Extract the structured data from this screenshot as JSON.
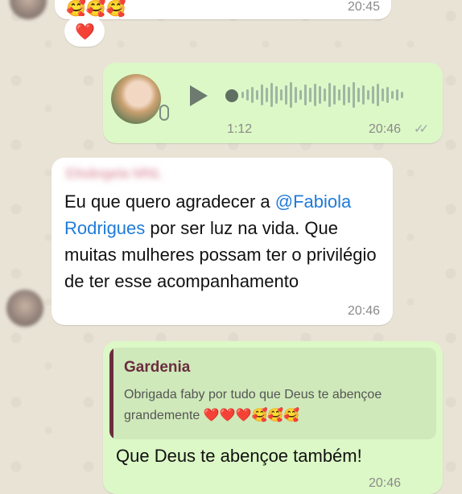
{
  "messages": {
    "top": {
      "emojis": "🥰🥰🥰",
      "time": "20:45"
    },
    "reaction": {
      "emoji": "❤️"
    },
    "voice": {
      "duration": "1:12",
      "time": "20:46"
    },
    "incoming": {
      "sender": "Elisângela MNL",
      "text_before": "Eu que quero agradecer a ",
      "mention": "@Fabiola Rodrigues",
      "text_after": " por ser luz na vida. Que muitas mulheres possam ter o privilégio de ter esse acompanhamento",
      "time": "20:46"
    },
    "reply": {
      "quoted_name": "Gardenia",
      "quoted_text": "Obrigada faby por tudo que Deus te abençoe grandemente ❤️❤️❤️🥰🥰🥰",
      "text": "Que Deus te abençoe também!",
      "time": "20:46"
    }
  },
  "colors": {
    "outgoing": "#dcf8c6",
    "incoming": "#ffffff",
    "mention": "#1f7bd8",
    "quote_name": "#6b2c3f",
    "quote_bar": "#6b2c3f"
  }
}
